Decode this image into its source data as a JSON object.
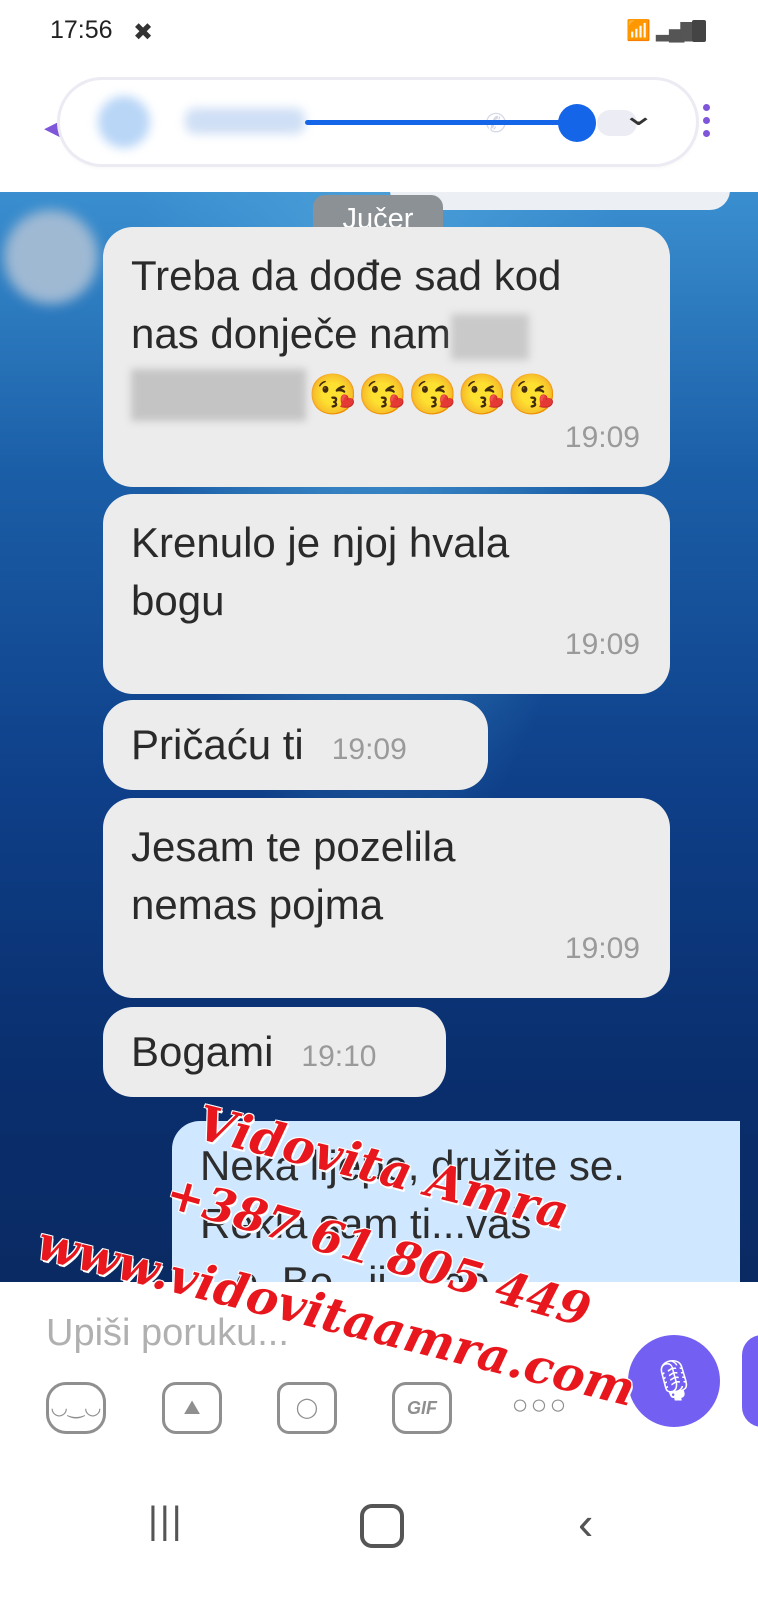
{
  "status_bar": {
    "time": "17:56"
  },
  "header": {
    "back_icon": "back-arrow-icon",
    "more_icon": "more-vert-icon",
    "chevron_icon": "chevron-down-icon"
  },
  "chat": {
    "date_separator": "Jučer",
    "messages": [
      {
        "lines": [
          "Treba da dođe sad kod",
          "nas donječe nam"
        ],
        "emojis": "😘😘😘😘😘",
        "time": "19:09"
      },
      {
        "lines": [
          "Krenulo je njoj hvala",
          "bogu"
        ],
        "time": "19:09"
      },
      {
        "lines": [
          "Pričaću ti"
        ],
        "time": "19:09"
      },
      {
        "lines": [
          "Jesam te pozelila",
          "nemas pojma"
        ],
        "time": "19:09"
      },
      {
        "lines": [
          "Bogami"
        ],
        "time": "19:10"
      }
    ],
    "outgoing_partial": {
      "line1": "Neka lijepo, družite se.",
      "line2": "Rekla sam ti...vaš",
      "line3": "...e. Bo...ji...kao"
    }
  },
  "watermark": {
    "line1": "Vidovita Amra",
    "line2": "+387 61 805 449",
    "line3": "www.vidovitaamra.com",
    "color": "#e8171d"
  },
  "composer": {
    "placeholder": "Upiši poruku...",
    "gif_label": "GIF",
    "icons": [
      "sticker-icon",
      "gallery-icon",
      "camera-icon",
      "gif-icon",
      "more-horiz-icon",
      "microphone-icon"
    ],
    "accent": "#7360f2"
  },
  "nav_bar": {
    "icons": [
      "recent-apps-icon",
      "home-icon",
      "back-icon"
    ]
  }
}
